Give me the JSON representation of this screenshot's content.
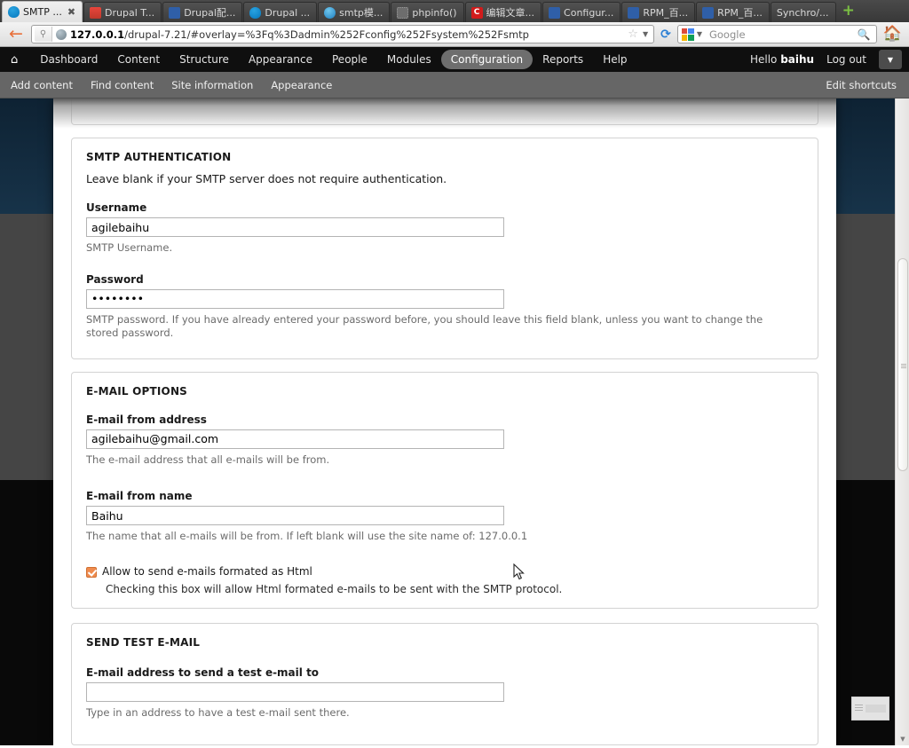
{
  "browser": {
    "tabs": [
      {
        "title": "SMTP ...",
        "favicon": "drupal-blue-icon",
        "active": true,
        "closable": true
      },
      {
        "title": "Drupal T...",
        "favicon": "drupal-red-icon",
        "active": false,
        "closable": false
      },
      {
        "title": "Drupal配...",
        "favicon": "blue-paw-icon",
        "active": false,
        "closable": false
      },
      {
        "title": "Drupal ...",
        "favicon": "drupal-blue-icon",
        "active": false,
        "closable": false
      },
      {
        "title": "smtp模...",
        "favicon": "smtp-icon",
        "active": false,
        "closable": false
      },
      {
        "title": "phpinfo()",
        "favicon": "generic-page-icon",
        "active": false,
        "closable": false
      },
      {
        "title": "编辑文章...",
        "favicon": "letter-c-icon",
        "active": false,
        "closable": false
      },
      {
        "title": "Configur...",
        "favicon": "blue-paw-icon",
        "active": false,
        "closable": false
      },
      {
        "title": "RPM_百...",
        "favicon": "blue-paw-icon",
        "active": false,
        "closable": false
      },
      {
        "title": "RPM_百...",
        "favicon": "blue-paw-icon",
        "active": false,
        "closable": false
      },
      {
        "title": "Synchro/...",
        "favicon": "no-icon",
        "active": false,
        "closable": false
      }
    ],
    "new_tab_label": "+",
    "close_glyph": "✖",
    "back_glyph": "←",
    "url_host": "127.0.0.1",
    "url_rest": "/drupal-7.21/#overlay=%3Fq%3Dadmin%252Fconfig%252Fsystem%252Fsmtp",
    "star_glyph": "☆",
    "caret_glyph": "▼",
    "reload_glyph": "⟳",
    "search_placeholder": "Google",
    "search_glyph": "🔍",
    "home_glyph": "🏠"
  },
  "drupal_toolbar": {
    "home_glyph": "⌂",
    "links": [
      {
        "label": "Dashboard",
        "active": false
      },
      {
        "label": "Content",
        "active": false
      },
      {
        "label": "Structure",
        "active": false
      },
      {
        "label": "Appearance",
        "active": false
      },
      {
        "label": "People",
        "active": false
      },
      {
        "label": "Modules",
        "active": false
      },
      {
        "label": "Configuration",
        "active": true
      },
      {
        "label": "Reports",
        "active": false
      },
      {
        "label": "Help",
        "active": false
      }
    ],
    "greeting_prefix": "Hello ",
    "username": "baihu",
    "logout_label": "Log out",
    "toggle_glyph": "▼"
  },
  "shortcut_bar": {
    "links": [
      "Add content",
      "Find content",
      "Site information",
      "Appearance"
    ],
    "edit_label": "Edit shortcuts"
  },
  "form": {
    "smtp_auth": {
      "legend": "SMTP AUTHENTICATION",
      "description": "Leave blank if your SMTP server does not require authentication.",
      "username": {
        "label": "Username",
        "value": "agilebaihu",
        "placeholder": "",
        "description": "SMTP Username."
      },
      "password": {
        "label": "Password",
        "value": "••••••••",
        "placeholder": "",
        "description": "SMTP password. If you have already entered your password before, you should leave this field blank, unless you want to change the stored password."
      }
    },
    "email_options": {
      "legend": "E-MAIL OPTIONS",
      "from_address": {
        "label": "E-mail from address",
        "value": "agilebaihu@gmail.com",
        "placeholder": "",
        "description": "The e-mail address that all e-mails will be from."
      },
      "from_name": {
        "label": "E-mail from name",
        "value": "Baihu",
        "placeholder": "",
        "description": "The name that all e-mails will be from. If left blank will use the site name of: 127.0.0.1"
      },
      "html_checkbox": {
        "label": "Allow to send e-mails formated as Html",
        "checked": true,
        "description": "Checking this box will allow Html formated e-mails to be sent with the SMTP protocol."
      }
    },
    "send_test": {
      "legend": "SEND TEST E-MAIL",
      "test_address": {
        "label": "E-mail address to send a test e-mail to",
        "value": "",
        "placeholder": "",
        "description": "Type in an address to have a test e-mail sent there."
      }
    }
  },
  "colors": {
    "accent_orange": "#ef8b4e",
    "toolbar_black": "#0f0f0f",
    "shortcut_gray": "#666666",
    "band_navy": "#173349",
    "band_gray": "#454545",
    "band_black": "#090909"
  }
}
